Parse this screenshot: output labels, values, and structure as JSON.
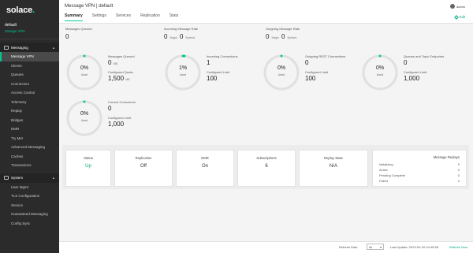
{
  "app": {
    "logo_text": "solace",
    "logo_dot": "."
  },
  "broker": {
    "name": "default",
    "vpn": "Orange VPN"
  },
  "sidebar": {
    "messaging_head": "Messaging",
    "messaging_items": [
      "Message VPN",
      "Clients",
      "Queues",
      "Connectors",
      "Access Control",
      "Telemetry",
      "Replay",
      "Bridges",
      "DMR",
      "Try Me!",
      "Advanced Messaging",
      "Caches",
      "Transactions"
    ],
    "system_head": "System",
    "system_items": [
      "User Mgmt",
      "TLS Configuration",
      "Service",
      "Guaranteed Messaging",
      "Config Sync"
    ]
  },
  "header": {
    "title": "Message VPN | default",
    "user": "admin",
    "tabs": [
      "Summary",
      "Settings",
      "Services",
      "Replication",
      "Stats"
    ],
    "edit_label": "Edit"
  },
  "stats": {
    "messages_queued": {
      "label": "Messages Queued",
      "value": "0"
    },
    "incoming_rate": {
      "label": "Incoming Message Rate",
      "msg": "0",
      "msg_unit": "Msg/s",
      "bytes": "0",
      "bytes_unit": "Bytes/s"
    },
    "outgoing_rate": {
      "label": "Outgoing Message Rate",
      "msg": "0",
      "msg_unit": "Msg/s",
      "bytes": "0",
      "bytes_unit": "Bytes/s"
    }
  },
  "gauges": [
    {
      "pct": "0%",
      "fill": 0,
      "used": "Used",
      "l1": "Messages Queued",
      "v1": "0",
      "v1_unit": "MB",
      "l2": "Configured Quota",
      "v2": "1,500",
      "v2_unit": "MB"
    },
    {
      "pct": "1%",
      "fill": 0.01,
      "used": "Used",
      "l1": "Incoming Connections",
      "v1": "1",
      "v1_unit": "",
      "l2": "Configured Limit",
      "v2": "100",
      "v2_unit": ""
    },
    {
      "pct": "0%",
      "fill": 0,
      "used": "Used",
      "l1": "Outgoing REST Connections",
      "v1": "0",
      "v1_unit": "",
      "l2": "Configured Limit",
      "v2": "100",
      "v2_unit": ""
    },
    {
      "pct": "0%",
      "fill": 0,
      "used": "Used",
      "l1": "Queues and Topic Endpoints",
      "v1": "0",
      "v1_unit": "",
      "l2": "Configured Limit",
      "v2": "1,000",
      "v2_unit": ""
    },
    {
      "pct": "0%",
      "fill": 0,
      "used": "Used",
      "l1": "Current Consumers",
      "v1": "0",
      "v1_unit": "",
      "l2": "Configured Limit",
      "v2": "1,000",
      "v2_unit": ""
    }
  ],
  "cards": [
    {
      "label": "Status",
      "value": "Up"
    },
    {
      "label": "Replication",
      "value": "Off"
    },
    {
      "label": "DMR",
      "value": "On"
    },
    {
      "label": "Subscriptions",
      "value": "6"
    },
    {
      "label": "Replay State",
      "value": "N/A"
    }
  ],
  "message_replays": {
    "title": "Message Replays",
    "rows": [
      {
        "label": "Initializing",
        "value": "0"
      },
      {
        "label": "Active",
        "value": "0"
      },
      {
        "label": "Pending Complete",
        "value": "0"
      },
      {
        "label": "Failed",
        "value": "0"
      }
    ]
  },
  "footer": {
    "refresh_label": "Refresh Rate",
    "refresh_value": "5s",
    "last_update": "Last Update: 2023-04-20 04:45:58",
    "refresh_now": "Refresh Now"
  },
  "colors": {
    "accent": "#00c895",
    "sidebar": "#2b2b2b",
    "gauge_track": "#e0e0e0",
    "gauge_fill": "#00c895"
  }
}
